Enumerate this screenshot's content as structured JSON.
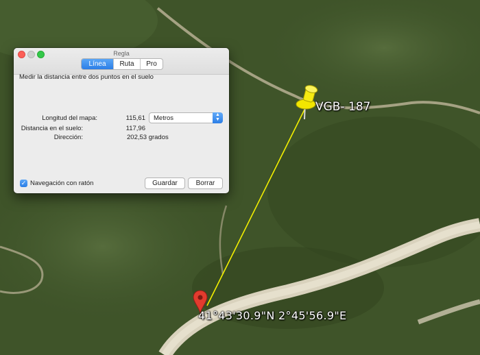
{
  "window": {
    "title": "Regla",
    "tabs": [
      {
        "label": "Línea",
        "active": true
      },
      {
        "label": "Ruta",
        "active": false
      },
      {
        "label": "Pro",
        "active": false
      }
    ],
    "description": "Medir la distancia entre dos puntos en el suelo",
    "map_length": {
      "label": "Longitud del mapa:",
      "value": "115,61",
      "unit": "Metros"
    },
    "ground_distance": {
      "label": "Distancia en el suelo:",
      "value": "117,96"
    },
    "heading": {
      "label": "Dirección:",
      "value": "202,53 grados"
    },
    "mouse_nav": {
      "label": "Navegación con ratón",
      "checked": true
    },
    "buttons": {
      "save": "Guardar",
      "clear": "Borrar"
    }
  },
  "map": {
    "placemark_label": "VGB- 187",
    "coordinate_label": "41°43'30.9\"N 2°45'56.9\"E"
  },
  "colors": {
    "accent": "#2c7ee6",
    "ruler_line": "#f4f000",
    "pushpin": "#f2e600",
    "pin": "#e23b2e"
  }
}
